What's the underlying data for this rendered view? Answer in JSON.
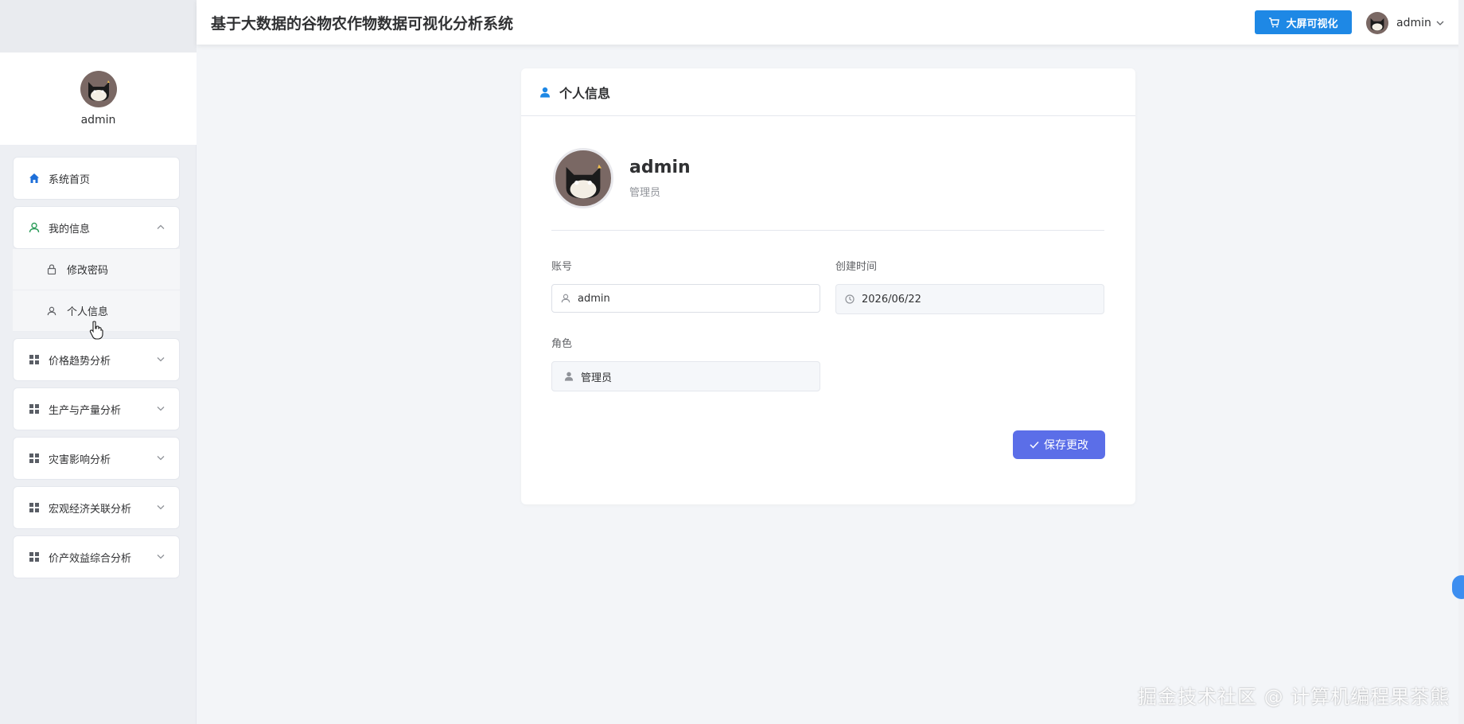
{
  "header": {
    "title": "基于大数据的谷物农作物数据可视化分析系统",
    "bigscreen_label": "大屏可视化",
    "username": "admin"
  },
  "sidebar": {
    "profile_name": "admin",
    "items": [
      {
        "label": "系统首页",
        "icon": "home-icon"
      },
      {
        "label": "我的信息",
        "icon": "user-icon",
        "expanded": true,
        "children": [
          {
            "label": "修改密码",
            "icon": "lock-icon"
          },
          {
            "label": "个人信息",
            "icon": "user-icon"
          }
        ]
      },
      {
        "label": "价格趋势分析",
        "icon": "grid-icon"
      },
      {
        "label": "生产与产量分析",
        "icon": "grid-icon"
      },
      {
        "label": "灾害影响分析",
        "icon": "grid-icon"
      },
      {
        "label": "宏观经济关联分析",
        "icon": "grid-icon"
      },
      {
        "label": "价产效益综合分析",
        "icon": "grid-icon"
      }
    ]
  },
  "card": {
    "title": "个人信息",
    "profile": {
      "name": "admin",
      "role": "管理员"
    },
    "fields": {
      "account_label": "账号",
      "account_value": "admin",
      "created_label": "创建时间",
      "created_value": "2026/06/22",
      "role_label": "角色",
      "role_value": "管理员"
    },
    "save_label": "保存更改"
  },
  "colors": {
    "primary": "#1e88e5",
    "save_button": "#5b6ee8",
    "active_icon": "#1e6fd9",
    "green_icon": "#2e9d5b"
  },
  "watermark": "掘金技术社区 @ 计算机编程果茶熊"
}
